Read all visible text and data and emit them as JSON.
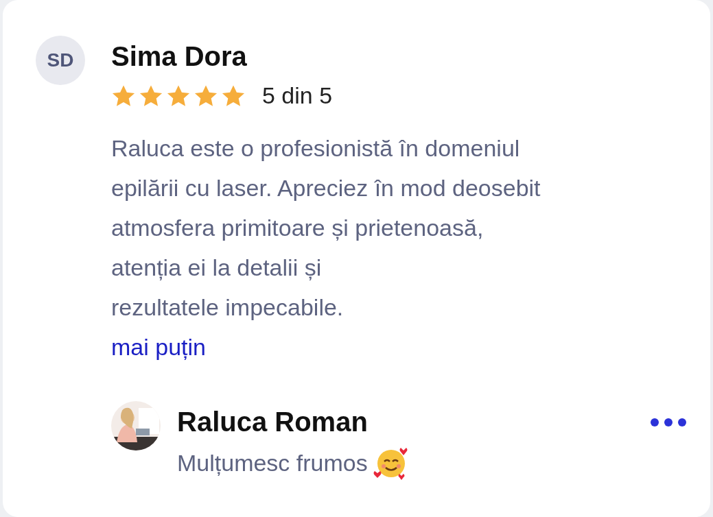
{
  "review": {
    "initials": "SD",
    "author": "Sima Dora",
    "stars": 5,
    "rating": "5 din 5",
    "text": "Raluca este o profesionistă în domeniul\nepilării cu laser. Apreciez în mod deosebit\natmosfera primitoare și prietenoasă,\natenția ei la detalii și\nrezultatele impecabile.",
    "toggle_link": "mai puțin"
  },
  "reply": {
    "author": "Raluca Roman",
    "text": "Mulțumesc frumos"
  }
}
